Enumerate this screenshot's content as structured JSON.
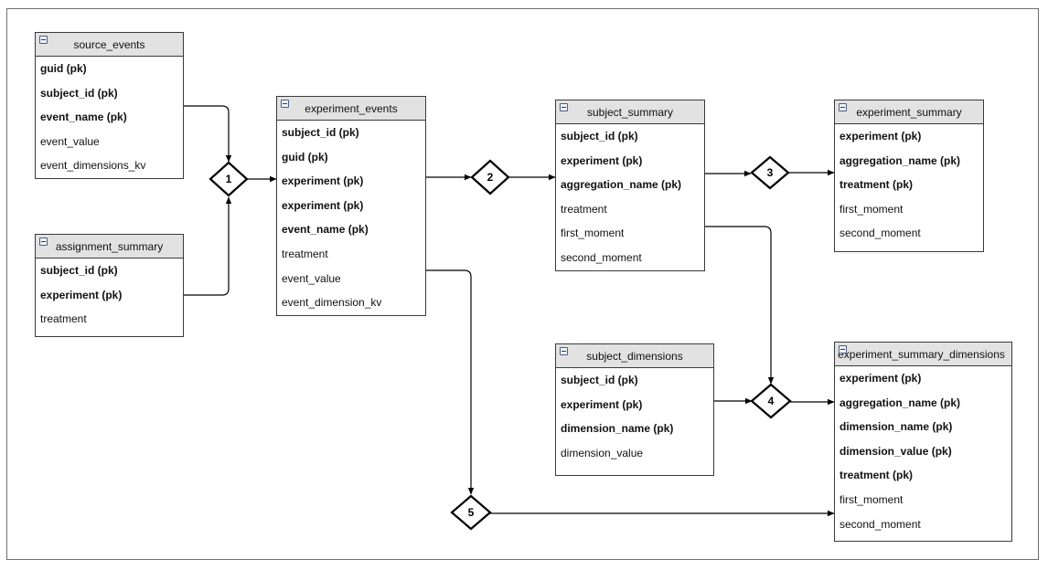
{
  "entities": {
    "source_events": {
      "title": "source_events",
      "fields": [
        {
          "name": "guid (pk)",
          "pk": true
        },
        {
          "name": "subject_id (pk)",
          "pk": true
        },
        {
          "name": "event_name (pk)",
          "pk": true
        },
        {
          "name": "event_value",
          "pk": false
        },
        {
          "name": "event_dimensions_kv",
          "pk": false
        }
      ]
    },
    "assignment_summary": {
      "title": "assignment_summary",
      "fields": [
        {
          "name": "subject_id (pk)",
          "pk": true
        },
        {
          "name": "experiment (pk)",
          "pk": true
        },
        {
          "name": "treatment",
          "pk": false
        }
      ]
    },
    "experiment_events": {
      "title": "experiment_events",
      "fields": [
        {
          "name": "subject_id (pk)",
          "pk": true
        },
        {
          "name": "guid (pk)",
          "pk": true
        },
        {
          "name": "experiment (pk)",
          "pk": true
        },
        {
          "name": "experiment (pk)",
          "pk": true
        },
        {
          "name": "event_name (pk)",
          "pk": true
        },
        {
          "name": "treatment",
          "pk": false
        },
        {
          "name": "event_value",
          "pk": false
        },
        {
          "name": "event_dimension_kv",
          "pk": false
        }
      ]
    },
    "subject_summary": {
      "title": "subject_summary",
      "fields": [
        {
          "name": "subject_id (pk)",
          "pk": true
        },
        {
          "name": "experiment (pk)",
          "pk": true
        },
        {
          "name": "aggregation_name (pk)",
          "pk": true
        },
        {
          "name": "treatment",
          "pk": false
        },
        {
          "name": "first_moment",
          "pk": false
        },
        {
          "name": "second_moment",
          "pk": false
        }
      ]
    },
    "experiment_summary": {
      "title": "experiment_summary",
      "fields": [
        {
          "name": "experiment (pk)",
          "pk": true
        },
        {
          "name": "aggregation_name (pk)",
          "pk": true
        },
        {
          "name": "treatment (pk)",
          "pk": true
        },
        {
          "name": "first_moment",
          "pk": false
        },
        {
          "name": "second_moment",
          "pk": false
        }
      ]
    },
    "subject_dimensions": {
      "title": "subject_dimensions",
      "fields": [
        {
          "name": "subject_id (pk)",
          "pk": true
        },
        {
          "name": "experiment (pk)",
          "pk": true
        },
        {
          "name": "dimension_name (pk)",
          "pk": true
        },
        {
          "name": "dimension_value",
          "pk": false
        }
      ]
    },
    "experiment_summary_dimensions": {
      "title": "experiment_summary_dimensions",
      "fields": [
        {
          "name": "experiment (pk)",
          "pk": true
        },
        {
          "name": "aggregation_name (pk)",
          "pk": true
        },
        {
          "name": "dimension_name (pk)",
          "pk": true
        },
        {
          "name": "dimension_value (pk)",
          "pk": true
        },
        {
          "name": "treatment (pk)",
          "pk": true
        },
        {
          "name": "first_moment",
          "pk": false
        },
        {
          "name": "second_moment",
          "pk": false
        }
      ]
    }
  },
  "steps": [
    {
      "id": "1",
      "label": "1",
      "inputs": [
        "source_events",
        "assignment_summary"
      ],
      "output": "experiment_events"
    },
    {
      "id": "2",
      "label": "2",
      "inputs": [
        "experiment_events"
      ],
      "output": "subject_summary"
    },
    {
      "id": "3",
      "label": "3",
      "inputs": [
        "subject_summary"
      ],
      "output": "experiment_summary"
    },
    {
      "id": "4",
      "label": "4",
      "inputs": [
        "subject_summary",
        "subject_dimensions"
      ],
      "output": "experiment_summary_dimensions"
    },
    {
      "id": "5",
      "label": "5",
      "inputs": [
        "experiment_events"
      ],
      "output": "experiment_summary_dimensions"
    }
  ],
  "icons": {
    "collapse": "collapse-toggle-icon"
  }
}
